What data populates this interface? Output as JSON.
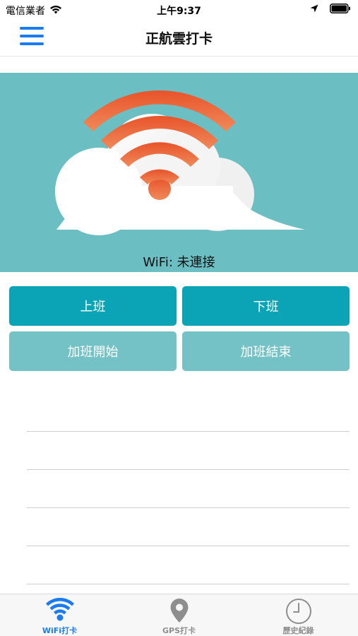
{
  "status_bar": {
    "carrier": "電信業者",
    "time": "上午9:37",
    "icons": [
      "wifi-icon",
      "location-arrow-icon",
      "battery-icon"
    ]
  },
  "nav": {
    "title": "正航雲打卡",
    "menu_icon": "hamburger-menu-icon"
  },
  "banner": {
    "illustration": "cloud-wifi-illustration",
    "wifi_status": "WiFi: 未連接",
    "colors": {
      "background": "#6bbfc3",
      "wifi_arc": "#e0582e",
      "cloud": "#ffffff"
    }
  },
  "actions": {
    "clock_in": "上班",
    "clock_out": "下班",
    "overtime_start": "加班開始",
    "overtime_end": "加班結束",
    "colors": {
      "primary": "#0aa4b6",
      "secondary": "#74c2c6"
    }
  },
  "tab_bar": {
    "tabs": [
      {
        "label": "WiFi打卡",
        "icon": "wifi-icon",
        "active": true
      },
      {
        "label": "GPS打卡",
        "icon": "map-pin-icon",
        "active": false
      },
      {
        "label": "歷史紀錄",
        "icon": "clock-icon",
        "active": false
      }
    ],
    "colors": {
      "active": "#1a7cf0",
      "inactive": "#8e8e8e"
    }
  }
}
